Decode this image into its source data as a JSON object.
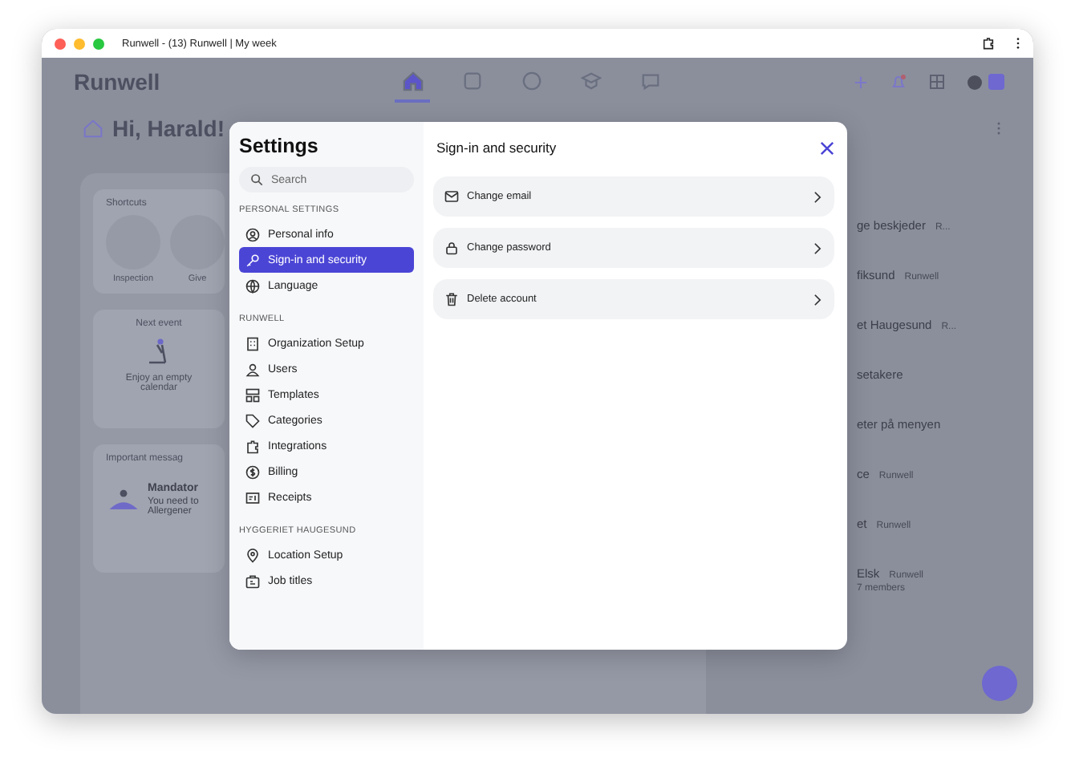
{
  "window": {
    "title": "Runwell - (13) Runwell | My week"
  },
  "app": {
    "logo": "Runwell",
    "nav": [
      {
        "selected": true
      },
      {
        "selected": false
      },
      {
        "selected": false
      },
      {
        "selected": false
      },
      {
        "selected": false
      }
    ],
    "greeting": "Hi, Harald!",
    "shortcuts": {
      "title": "Shortcuts",
      "items": [
        "Inspection",
        "Give"
      ]
    },
    "next_event": {
      "title": "Next event",
      "empty": "Enjoy an empty calendar"
    },
    "messages": {
      "title": "Important messag",
      "item_title": "Mandator",
      "item_text": "You need to Allergener"
    },
    "groups": [
      {
        "name": "ge beskjeder",
        "tag": "R..."
      },
      {
        "name": "fiksund",
        "tag": "Runwell"
      },
      {
        "name": "et Haugesund",
        "tag": "R..."
      },
      {
        "name": "setakere"
      },
      {
        "name": "eter på menyen"
      },
      {
        "name": "ce",
        "tag": "Runwell"
      },
      {
        "name": "et",
        "tag": "Runwell"
      },
      {
        "name": "Elsk",
        "tag": "Runwell",
        "sub": "7 members"
      }
    ]
  },
  "settings": {
    "title": "Settings",
    "search": {
      "placeholder": "Search"
    },
    "sections": [
      {
        "heading": "PERSONAL SETTINGS",
        "items": [
          {
            "label": "Personal info",
            "selected": false
          },
          {
            "label": "Sign-in and security",
            "selected": true
          },
          {
            "label": "Language",
            "selected": false
          }
        ]
      },
      {
        "heading": "RUNWELL",
        "items": [
          {
            "label": "Organization Setup",
            "selected": false
          },
          {
            "label": "Users",
            "selected": false
          },
          {
            "label": "Templates",
            "selected": false
          },
          {
            "label": "Categories",
            "selected": false
          },
          {
            "label": "Integrations",
            "selected": false
          },
          {
            "label": "Billing",
            "selected": false
          },
          {
            "label": "Receipts",
            "selected": false
          }
        ]
      },
      {
        "heading": "HYGGERIET HAUGESUND",
        "items": [
          {
            "label": "Location Setup",
            "selected": false
          },
          {
            "label": "Job titles",
            "selected": false
          }
        ]
      }
    ],
    "panel": {
      "title": "Sign-in and security",
      "options": [
        {
          "label": "Change email"
        },
        {
          "label": "Change password"
        },
        {
          "label": "Delete account"
        }
      ]
    }
  }
}
